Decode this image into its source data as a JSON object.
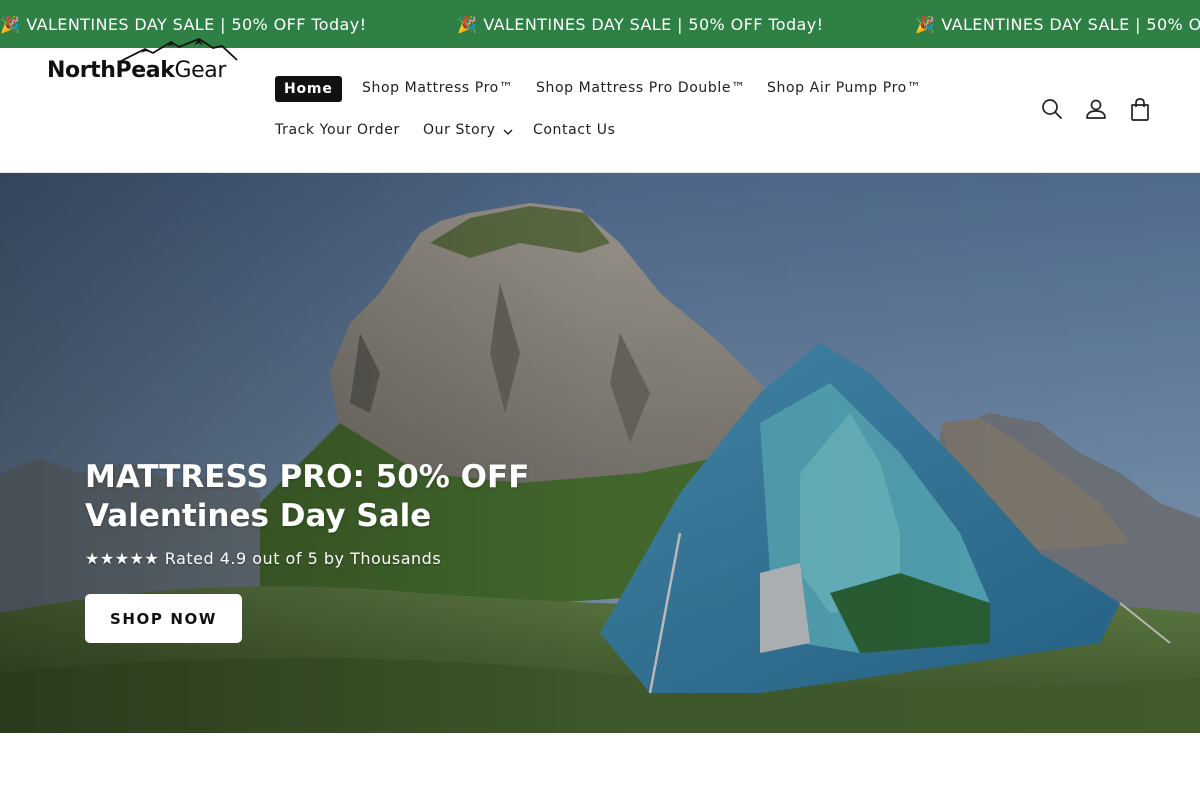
{
  "announcement": {
    "text": "VALENTINES DAY SALE | 50% OFF Today!",
    "emoji": "🎉",
    "background": "#2f8045"
  },
  "header": {
    "logo": {
      "part1": "NorthPeak",
      "part2": "Gear"
    },
    "nav": [
      {
        "label": "Home",
        "active": true
      },
      {
        "label": "Shop Mattress Pro™"
      },
      {
        "label": "Shop Mattress Pro Double™"
      },
      {
        "label": "Shop Air Pump Pro™"
      },
      {
        "label": "Track Your Order"
      },
      {
        "label": "Our Story",
        "has_dropdown": true
      },
      {
        "label": "Contact Us"
      }
    ],
    "icons": [
      "search-icon",
      "account-icon",
      "cart-icon"
    ]
  },
  "hero": {
    "title_line1": "MATTRESS PRO: 50% OFF",
    "title_line2": "Valentines Day Sale",
    "rating": "★★★★★ Rated 4.9 out of 5 by Thousands",
    "cta": "SHOP NOW"
  }
}
